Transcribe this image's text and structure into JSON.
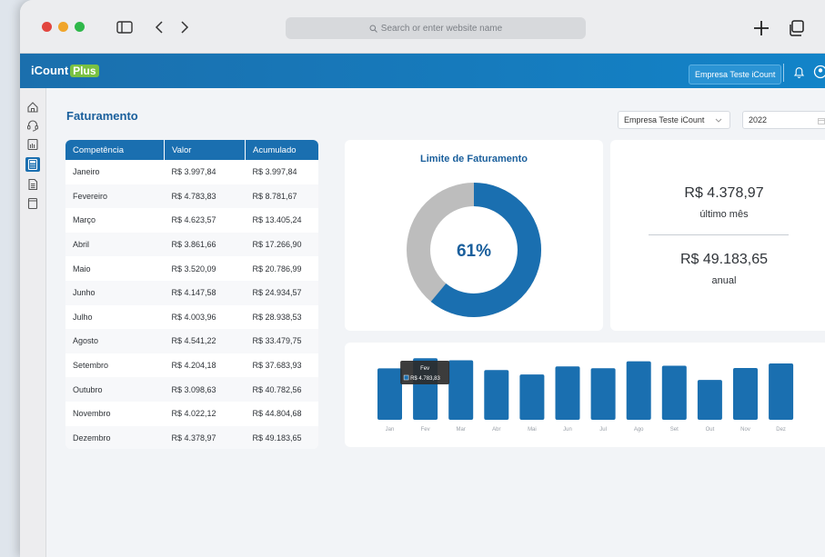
{
  "browser": {
    "search_placeholder": "Search or enter website name"
  },
  "app": {
    "logo_main": "iCount",
    "logo_plus": "Plus",
    "company_button": "Empresa Teste iCount"
  },
  "page": {
    "title": "Faturamento",
    "company_select": "Empresa Teste iCount",
    "year_select": "2022"
  },
  "table": {
    "headers": [
      "Competência",
      "Valor",
      "Acumulado"
    ],
    "rows": [
      [
        "Janeiro",
        "R$ 3.997,84",
        "R$ 3.997,84"
      ],
      [
        "Fevereiro",
        "R$ 4.783,83",
        "R$ 8.781,67"
      ],
      [
        "Março",
        "R$ 4.623,57",
        "R$ 13.405,24"
      ],
      [
        "Abril",
        "R$ 3.861,66",
        "R$ 17.266,90"
      ],
      [
        "Maio",
        "R$ 3.520,09",
        "R$ 20.786,99"
      ],
      [
        "Junho",
        "R$ 4.147,58",
        "R$ 24.934,57"
      ],
      [
        "Julho",
        "R$ 4.003,96",
        "R$ 28.938,53"
      ],
      [
        "Agosto",
        "R$ 4.541,22",
        "R$ 33.479,75"
      ],
      [
        "Setembro",
        "R$ 4.204,18",
        "R$ 37.683,93"
      ],
      [
        "Outubro",
        "R$ 3.098,63",
        "R$ 40.782,56"
      ],
      [
        "Novembro",
        "R$ 4.022,12",
        "R$ 44.804,68"
      ],
      [
        "Dezembro",
        "R$ 4.378,97",
        "R$ 49.183,65"
      ]
    ]
  },
  "limit": {
    "title": "Limite de Faturamento",
    "percent_label": "61%",
    "percent_value": 0.61,
    "fill_color": "#1a6fb0",
    "rest_color": "#bdbdbd"
  },
  "summary": {
    "last_month_value": "R$ 4.378,97",
    "last_month_label": "último mês",
    "annual_value": "R$ 49.183,65",
    "annual_label": "anual"
  },
  "chart_data": {
    "type": "bar",
    "categories": [
      "Jan",
      "Fev",
      "Mar",
      "Abr",
      "Mai",
      "Jun",
      "Jul",
      "Ago",
      "Set",
      "Out",
      "Nov",
      "Dez"
    ],
    "values": [
      3997.84,
      4783.83,
      4623.57,
      3861.66,
      3520.09,
      4147.58,
      4003.96,
      4541.22,
      4204.18,
      3098.63,
      4022.12,
      4378.97
    ],
    "ylim": [
      0,
      4800
    ],
    "bar_color": "#1a6fb0",
    "tooltip": {
      "label": "Fev",
      "value": "R$ 4.783,83"
    }
  }
}
